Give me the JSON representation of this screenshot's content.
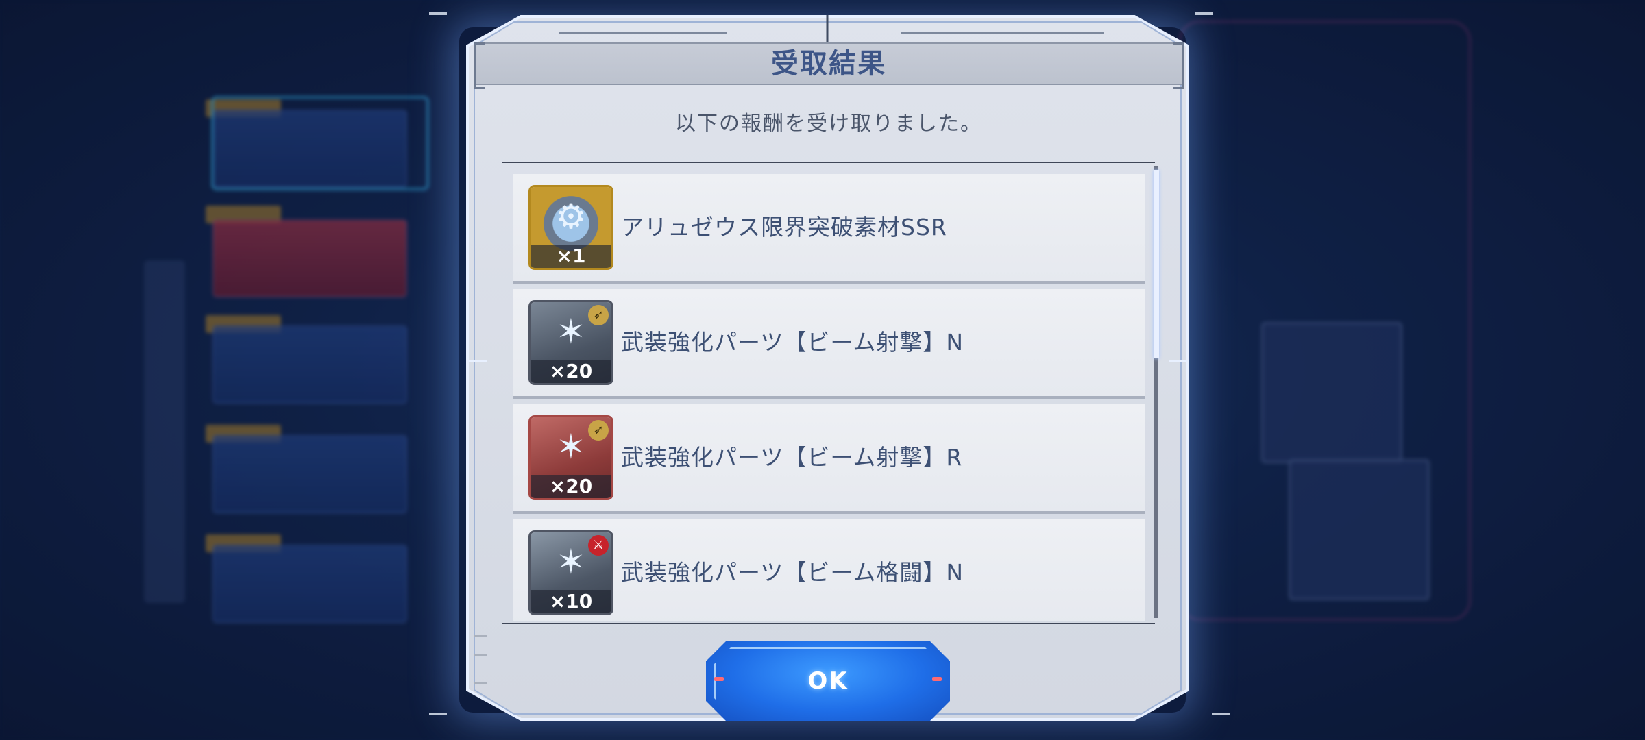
{
  "dialog": {
    "title": "受取結果",
    "subtitle": "以下の報酬を受け取りました。",
    "ok_label": "OK"
  },
  "rewards": [
    {
      "name": "アリュゼウス限界突破素材SSR",
      "count": "×1",
      "icon": "gundam-unit-ssr-icon",
      "rarity_color": "#c59a2f"
    },
    {
      "name": "武装強化パーツ【ビーム射撃】N",
      "count": "×20",
      "icon": "beam-shooting-part-n-icon",
      "rarity_color": "#5a6473"
    },
    {
      "name": "武装強化パーツ【ビーム射撃】R",
      "count": "×20",
      "icon": "beam-shooting-part-r-icon",
      "rarity_color": "#a54845"
    },
    {
      "name": "武装強化パーツ【ビーム格闘】N",
      "count": "×10",
      "icon": "beam-melee-part-n-icon",
      "rarity_color": "#5a6473"
    }
  ],
  "colors": {
    "accent_blue": "#1f6ee8",
    "title_text": "#3d5587",
    "panel_bg": "#dfe3ec"
  }
}
